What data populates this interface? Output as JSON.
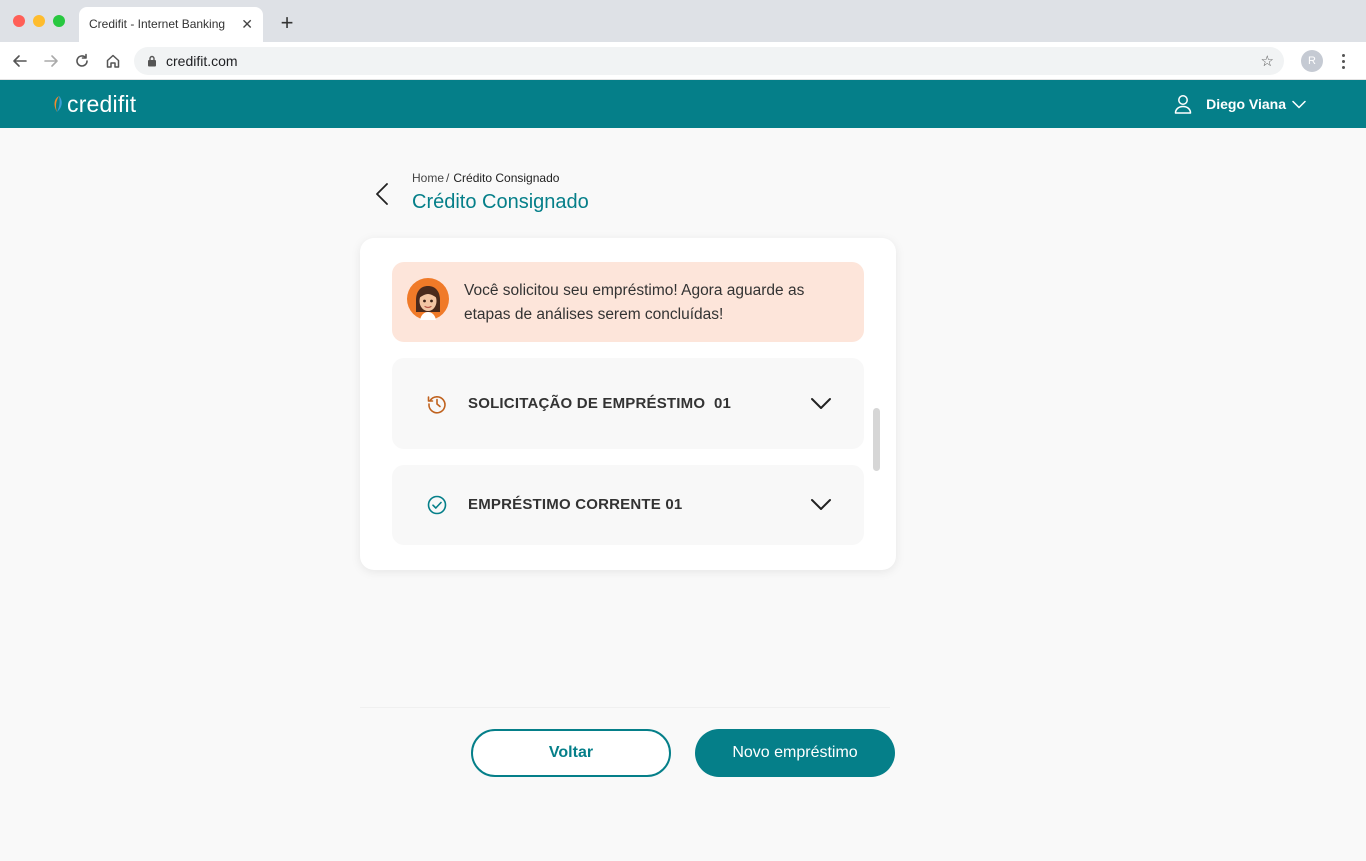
{
  "browser": {
    "tab_title": "Credifit - Internet Banking",
    "tab_close": "✕",
    "new_tab": "+",
    "url": "credifit.com",
    "profile_initial": "R"
  },
  "header": {
    "logo_text": "credifit",
    "user_name": "Diego Viana"
  },
  "breadcrumb": {
    "home": "Home",
    "separator": "/",
    "current": "Crédito Consignado"
  },
  "page_title": "Crédito Consignado",
  "alert": {
    "message": "Você solicitou seu empréstimo! Agora aguarde as etapas de análises serem concluídas!"
  },
  "accordions": [
    {
      "label": "SOLICITAÇÃO DE EMPRÉSTIMO  01",
      "icon": "history-clock-icon",
      "icon_color": "#c0621e"
    },
    {
      "label": "EMPRÉSTIMO CORRENTE 01",
      "icon": "check-circle-icon",
      "icon_color": "#057f89"
    }
  ],
  "actions": {
    "back_label": "Voltar",
    "new_loan_label": "Novo empréstimo"
  },
  "colors": {
    "brand": "#057f89",
    "alert_bg": "#fde5da",
    "pending": "#c0621e"
  }
}
